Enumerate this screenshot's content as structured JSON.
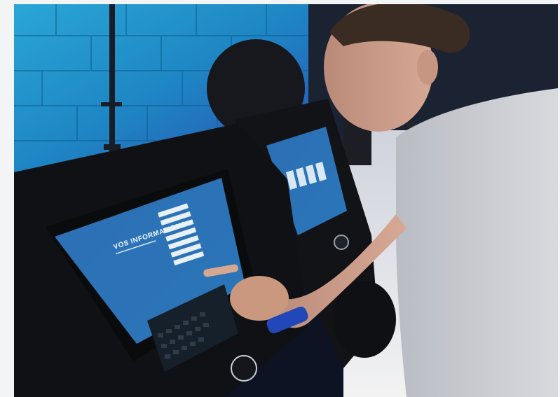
{
  "photo": {
    "front_kiosk_screen": {
      "heading": "VOS INFORMATIONS"
    }
  }
}
